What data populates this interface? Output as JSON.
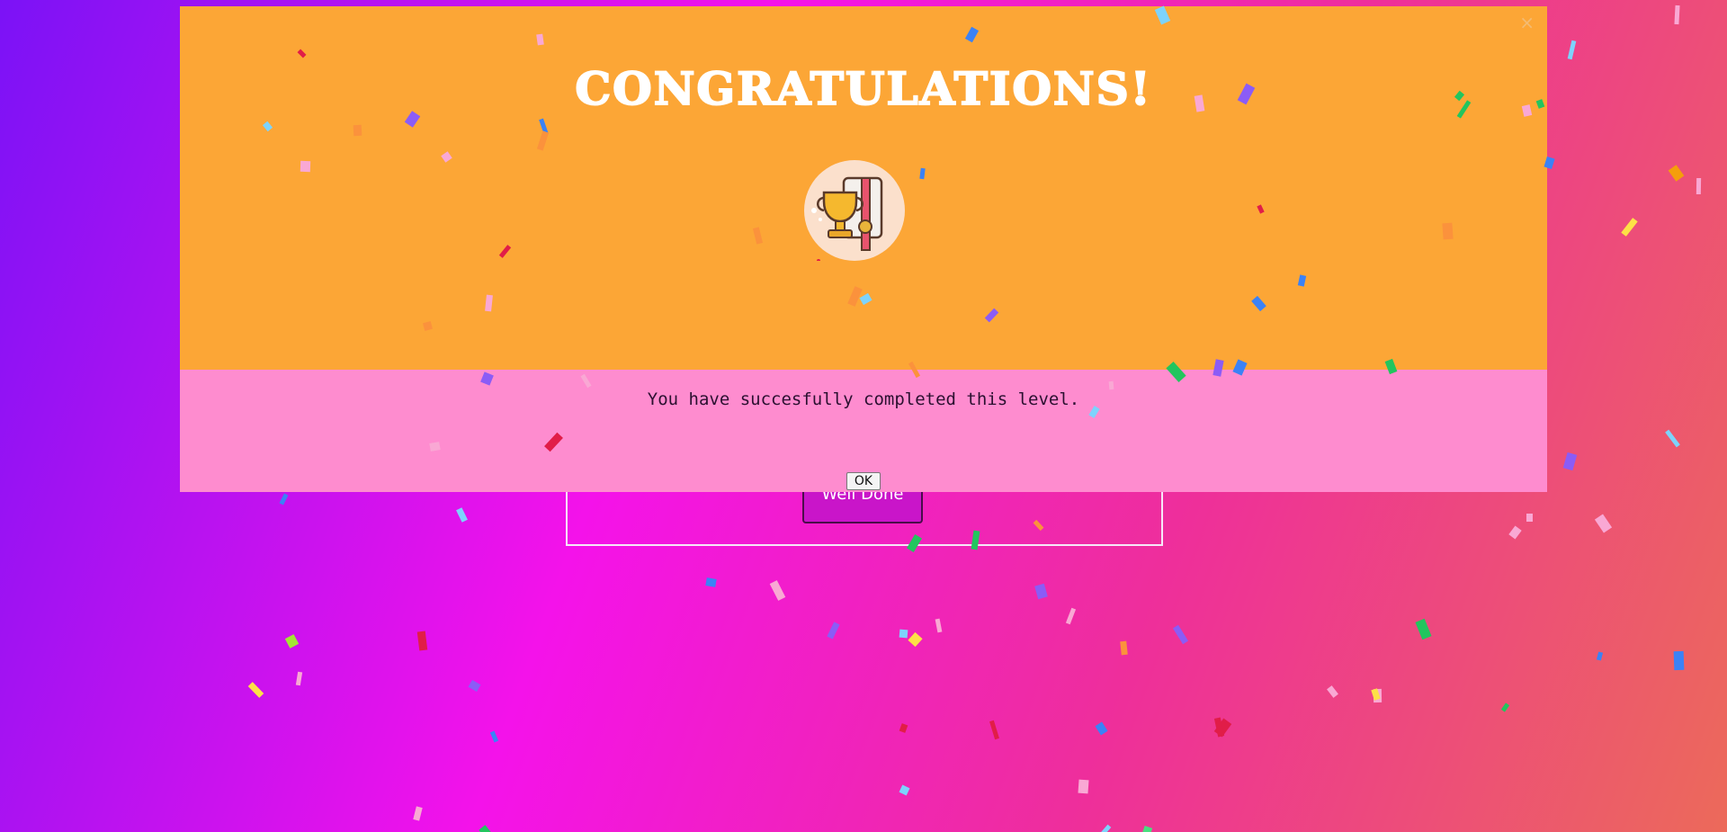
{
  "modal": {
    "title": "CONGRATULATIONS!",
    "message": "You have succesfully completed this level.",
    "ok_label": "OK",
    "close_label": "×",
    "header_color": "#fca636",
    "body_color": "#fe8ccf",
    "icon": "trophy-certificate-icon"
  },
  "game": {
    "well_done_label": "Well Done"
  },
  "colors": {
    "confetti": [
      "#e11d48",
      "#3b82f6",
      "#f59e0b",
      "#8b5cf6",
      "#22c55e",
      "#fde047",
      "#f9a8d4",
      "#7dd3fc",
      "#a3e635",
      "#fb923c",
      "#4ade80",
      "#c084fc"
    ]
  }
}
